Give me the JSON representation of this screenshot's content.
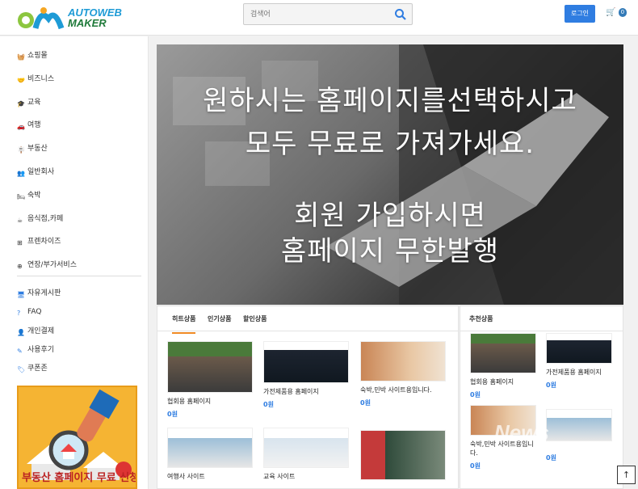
{
  "header": {
    "logo_line1": "AUTOWEB",
    "logo_line2": "MAKER",
    "search_placeholder": "검색어",
    "login_label": "로그인",
    "cart_count": "0"
  },
  "sidebar": {
    "items": [
      {
        "label": "쇼핑몰",
        "icon": "basket-icon"
      },
      {
        "label": "비즈니스",
        "icon": "handshake-icon"
      },
      {
        "label": "교육",
        "icon": "graduation-cap-icon"
      },
      {
        "label": "여행",
        "icon": "car-icon"
      },
      {
        "label": "부동산",
        "icon": "signpost-icon"
      },
      {
        "label": "일반회사",
        "icon": "users-icon"
      },
      {
        "label": "숙박",
        "icon": "bed-icon"
      },
      {
        "label": "음식점,카페",
        "icon": "coffee-icon"
      },
      {
        "label": "프렌차이즈",
        "icon": "sitemap-icon"
      },
      {
        "label": "연장/부가서비스",
        "icon": "plus-square-icon"
      }
    ],
    "links": [
      {
        "label": "자유게시판",
        "icon": "monitor-icon"
      },
      {
        "label": "FAQ",
        "icon": "question-circle-icon"
      },
      {
        "label": "개인결제",
        "icon": "user-plus-icon"
      },
      {
        "label": "사용후기",
        "icon": "pencil-icon"
      },
      {
        "label": "쿠폰존",
        "icon": "tags-icon"
      }
    ],
    "ad_text": "부동산 홈페이지 무료 신청"
  },
  "hero": {
    "line1": "원하시는 홈페이지를선택하시고",
    "line2": "모두 무료로 가져가세요.",
    "line3": "회원 가입하시면",
    "line4": "홈페이지 무한발행"
  },
  "products_panel": {
    "tabs": [
      "히트상품",
      "인기상품",
      "할인상품"
    ],
    "items": [
      {
        "name": "협회용 홈페이지",
        "price": "0원"
      },
      {
        "name": "가전제품용 홈페이지",
        "price": "0원"
      },
      {
        "name": "숙박,민박 사이트용입니다.",
        "price": "0원"
      },
      {
        "name": "여행사 사이트",
        "price": ""
      },
      {
        "name": "교육 사이트",
        "price": ""
      },
      {
        "name": "",
        "price": ""
      }
    ]
  },
  "recommend_panel": {
    "title": "추천상품",
    "items": [
      {
        "name": "협회용 홈페이지",
        "price": "0원"
      },
      {
        "name": "가전제품용 홈페이지",
        "price": "0원"
      },
      {
        "name": "숙박,민박 사이트용입니다.",
        "price": "0원"
      },
      {
        "name": "",
        "price": "0원"
      }
    ]
  },
  "watermark": "News",
  "top_button": "↑",
  "colors": {
    "accent": "#2f7de1",
    "tab_active": "#f08a24",
    "ad_bg": "#f5b433"
  }
}
